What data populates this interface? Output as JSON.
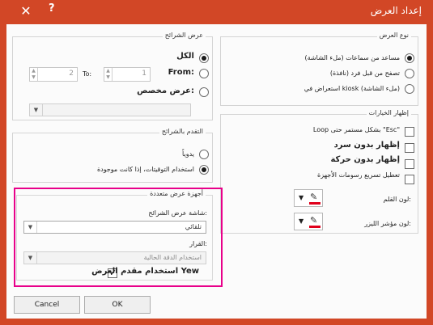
{
  "window": {
    "title": "إعداد العرض",
    "help_symbol": "?",
    "close_symbol": "✕"
  },
  "show_type": {
    "legend": "نوع العرض",
    "options": [
      {
        "label": "(مساعد من سماعات (ملء الشاشة",
        "selected": true
      },
      {
        "label": "تصفح من قبل فرد (نافذة)",
        "selected": false
      },
      {
        "label": "استعراض في kiosk (ملء الشاشة)",
        "selected": false
      }
    ]
  },
  "show_options": {
    "legend": "إظهار الخيارات",
    "items": [
      {
        "label": "Loop بشكل مستمر حتى \"Esc\"",
        "checked": false,
        "bold": false
      },
      {
        "label": "إظهار بدون سرد",
        "checked": false,
        "bold": true
      },
      {
        "label": "إظهار بدون حركة",
        "checked": false,
        "bold": true
      },
      {
        "label": "تعطيل تسريع رسومات الأجهزة",
        "checked": false,
        "bold": false
      }
    ],
    "pen_color_label": "لون القلم:",
    "laser_color_label": "لون مؤشر الليزر:",
    "pen_color": "#e0001b",
    "laser_color": "#e0001b"
  },
  "show_slides": {
    "legend": "عرض الشرائح",
    "all_label": "الكل",
    "from_label": "From:",
    "from_value": "1",
    "to_label": "To:",
    "to_value": "2",
    "custom_label": "عرض مخصص:",
    "custom_combo_value": ""
  },
  "advance_slides": {
    "legend": "التقدم بالشرائح",
    "options": [
      {
        "label": "يدوياً",
        "selected": false
      },
      {
        "label": "استخدام التوقيتات، إذا كانت موجودة",
        "selected": true
      }
    ]
  },
  "multiple_monitors": {
    "legend": "أجهزة عرض متعددة",
    "monitor_label": "شاشة عرض الشرائح:",
    "monitor_value": "تلقائي",
    "resolution_label": "القرار:",
    "resolution_value": "استخدام الدقة الحالية",
    "presenter_view_label": "استخدام مقدم العرض Yew",
    "presenter_view_checked": true
  },
  "buttons": {
    "ok": "OK",
    "cancel": "Cancel"
  }
}
